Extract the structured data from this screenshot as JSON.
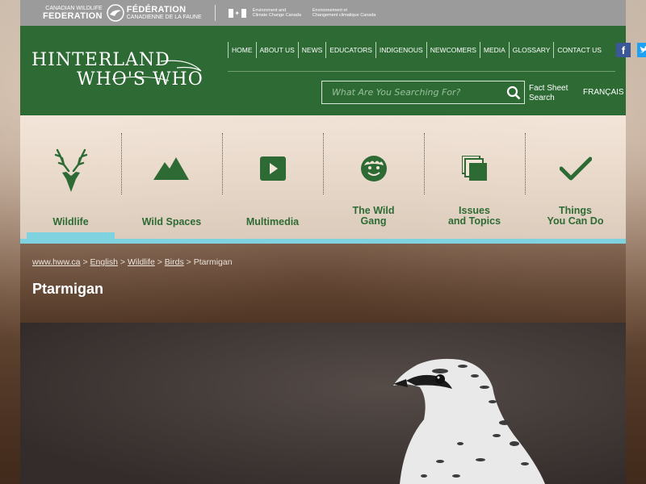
{
  "partners": {
    "cwf_en_small": "CANADIAN WILDLIFE",
    "cwf_en_big": "FEDERATION",
    "cwf_fr_big": "FÉDÉRATION",
    "cwf_fr_small": "CANADIENNE DE LA FAUNE",
    "ecc_en_1": "Environment and",
    "ecc_en_2": "Climate Change Canada",
    "ecc_fr_1": "Environnement et",
    "ecc_fr_2": "Changement climatique Canada"
  },
  "logo": {
    "line1": "HINTERLAND",
    "line2": "WHO'S WHO"
  },
  "topnav": {
    "items": [
      "HOME",
      "ABOUT US",
      "NEWS",
      "EDUCATORS",
      "INDIGENOUS",
      "NEWCOMERS",
      "MEDIA",
      "GLOSSARY",
      "CONTACT US"
    ]
  },
  "social": {
    "facebook": "facebook-icon",
    "twitter": "twitter-icon",
    "youtube": "youtube-icon"
  },
  "search": {
    "placeholder": "What Are You Searching For?",
    "factsheet_line1": "Fact Sheet",
    "factsheet_line2": "Search",
    "language": "FRANÇAIS"
  },
  "mainnav": {
    "items": [
      {
        "line1": "Wildlife",
        "line2": "",
        "icon": "deer-icon",
        "active": true
      },
      {
        "line1": "Wild Spaces",
        "line2": "",
        "icon": "mountain-icon"
      },
      {
        "line1": "Multimedia",
        "line2": "",
        "icon": "play-icon"
      },
      {
        "line1": "The Wild",
        "line2": "Gang",
        "icon": "face-icon"
      },
      {
        "line1": "Issues",
        "line2": "and Topics",
        "icon": "pages-icon"
      },
      {
        "line1": "Things",
        "line2": "You Can Do",
        "icon": "checkmark-icon"
      }
    ]
  },
  "breadcrumb": {
    "home": "www.hww.ca",
    "english": "English",
    "wildlife": "Wildlife",
    "birds": "Birds",
    "current": "Ptarmigan"
  },
  "page": {
    "title": "Ptarmigan"
  },
  "colors": {
    "header_green": "#2e6b34",
    "accent_blue": "#7fd3e0",
    "partner_gray": "#9b9b9b"
  }
}
